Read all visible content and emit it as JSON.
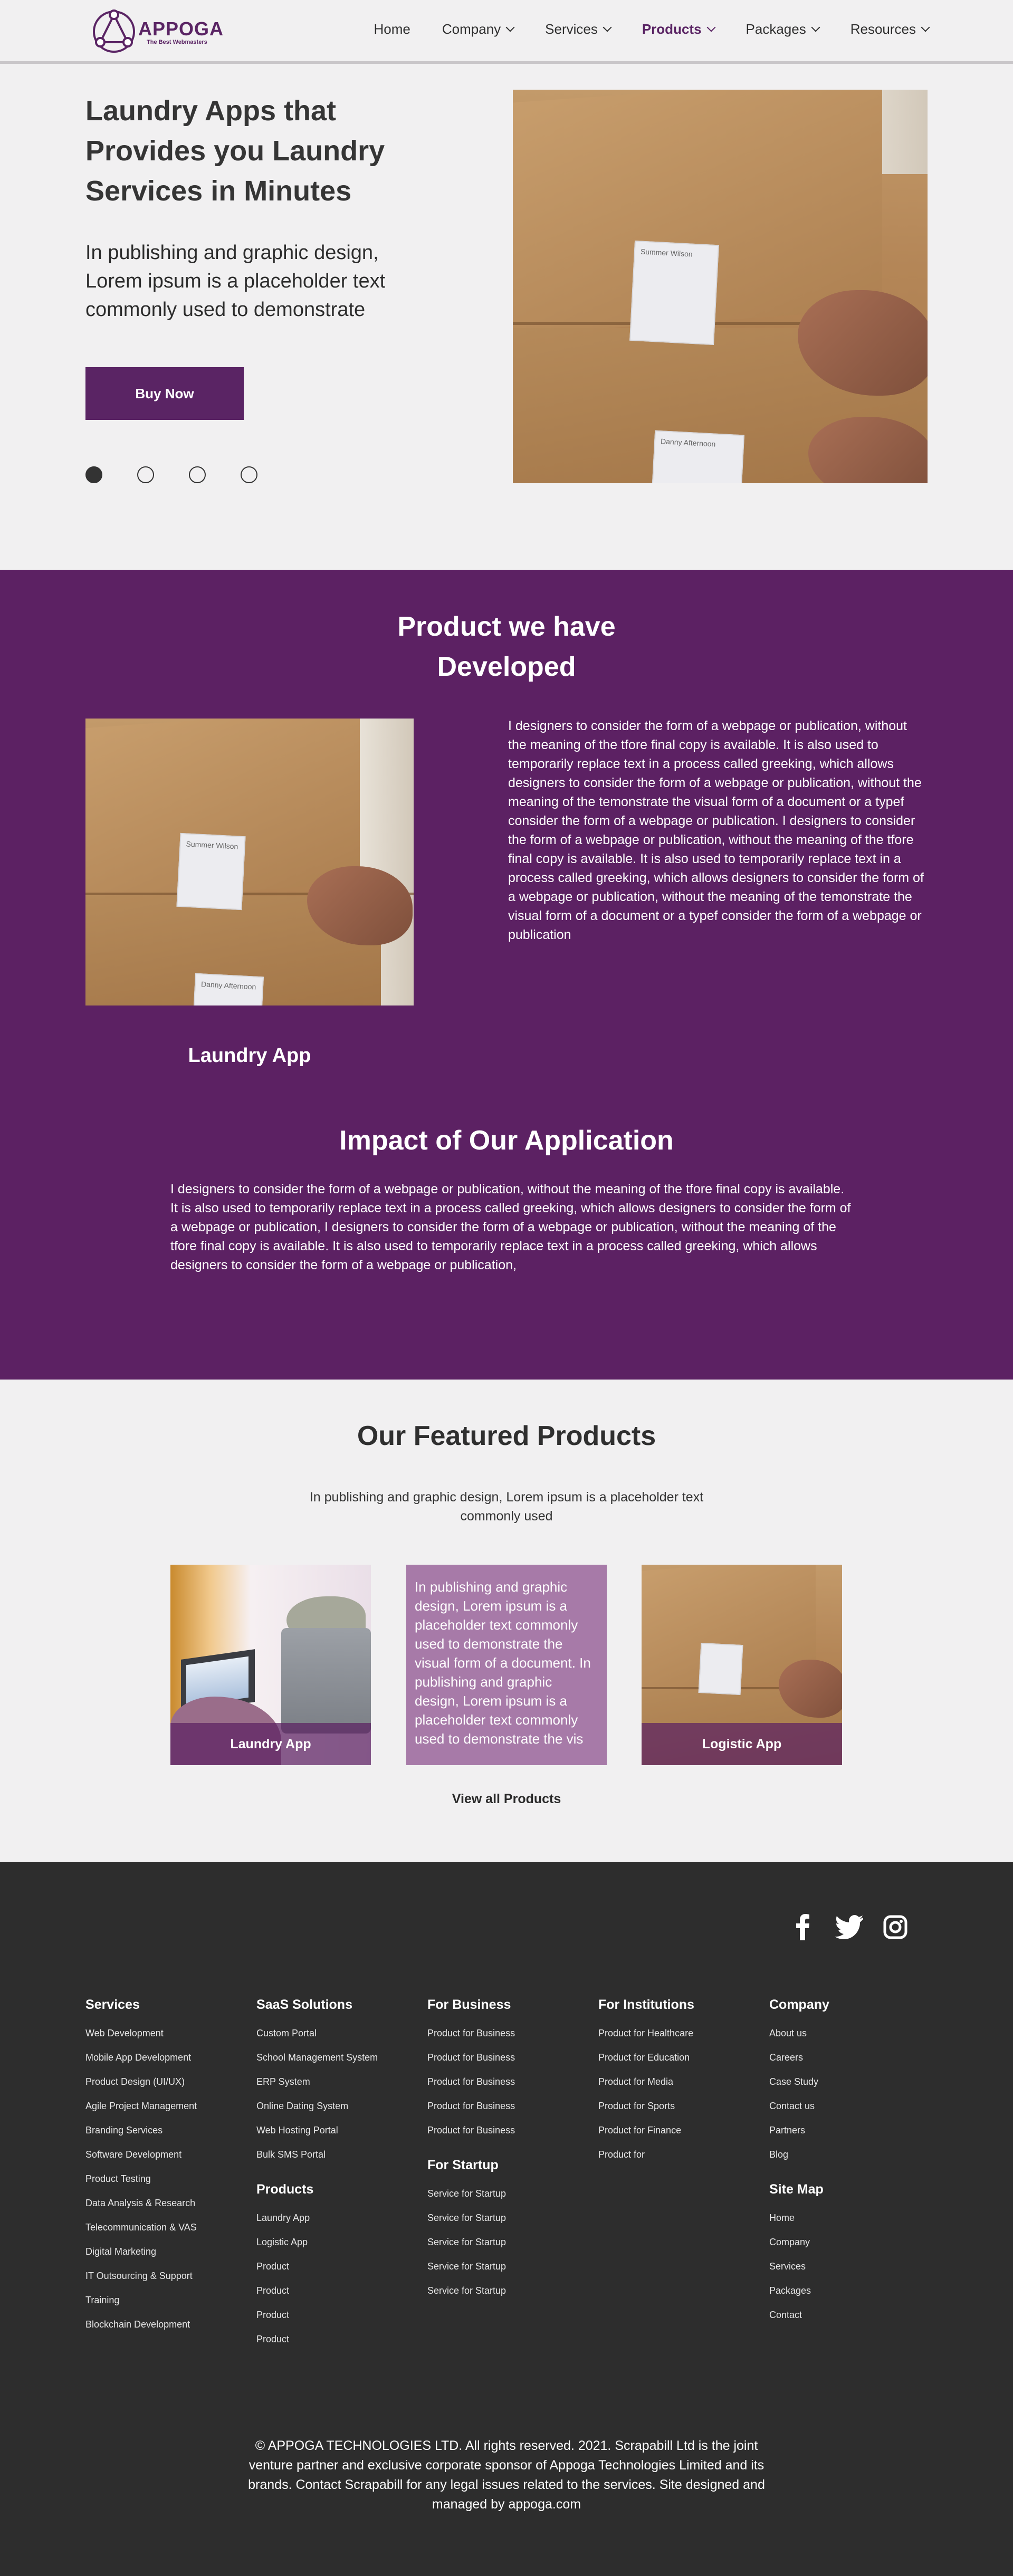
{
  "brand": {
    "name": "APPOGA",
    "tagline": "The Best Webmasters",
    "color_primary": "#5c2163",
    "color_dark": "#2d2d2d"
  },
  "nav": {
    "items": [
      {
        "label": "Home",
        "dropdown": false
      },
      {
        "label": "Company",
        "dropdown": true
      },
      {
        "label": "Services",
        "dropdown": true
      },
      {
        "label": "Products",
        "dropdown": true,
        "active": true
      },
      {
        "label": "Packages",
        "dropdown": true
      },
      {
        "label": "Resources",
        "dropdown": true
      }
    ]
  },
  "hero": {
    "title": "Laundry Apps that Provides you Laundry Services in Minutes",
    "subtitle": "In publishing and graphic design, Lorem ipsum is a placeholder text commonly used to demonstrate",
    "button": "Buy Now",
    "slides": 4,
    "active_slide": 1,
    "box_labels": [
      "Summer Wilson",
      "Danny Afternoon"
    ]
  },
  "products_section": {
    "title": "Product we have Developed",
    "description": "I designers to consider the form of a webpage or publication, without the meaning of the tfore final copy is available. It is also used to temporarily replace text in a process called greeking, which allows designers to consider the form of a webpage or publication, without the meaning of the temonstrate the visual form of a document or a typef consider the form of a webpage or publication. I designers to consider the form of a webpage or publication, without the meaning of the tfore final copy is available. It is also used to temporarily replace text in a process called greeking, which allows designers to consider the form of a webpage or publication, without the meaning of the temonstrate the visual form of a document or a typef consider the form of a webpage or publication",
    "product_name": "Laundry App"
  },
  "impact": {
    "title": "Impact of Our Application",
    "text": "I designers to consider the form of a webpage or publication, without the meaning of the tfore final copy is available. It is also used to temporarily replace text in a process called greeking, which allows designers to consider the form of a webpage or publication,  I designers to consider the form of a webpage or publication, without the meaning of the tfore final copy is available. It is also used to temporarily replace text in a process called greeking, which allows designers to consider the form of a webpage or publication,"
  },
  "featured": {
    "title": "Our Featured Products",
    "subtitle": "In publishing and graphic design, Lorem ipsum is a placeholder text commonly used",
    "cards": [
      {
        "caption": "Laundry App"
      },
      {
        "text": "In publishing and graphic design, Lorem ipsum is a placeholder text commonly used to demonstrate the visual form of a document. In publishing and graphic design, Lorem ipsum is a placeholder text commonly used to demonstrate the vis"
      },
      {
        "caption": "Logistic App"
      }
    ],
    "view_all": "View all Products"
  },
  "footer": {
    "social_icons": [
      "facebook-icon",
      "twitter-icon",
      "instagram-icon"
    ],
    "columns": [
      {
        "title": "Services",
        "links": [
          "Web Development",
          "Mobile App Development",
          "Product Design (UI/UX)",
          "Agile Project Management",
          "Branding Services",
          "Software Development",
          "Product Testing",
          "Data Analysis & Research",
          "Telecommunication & VAS",
          "Digital Marketing",
          "IT Outsourcing & Support",
          "Training",
          "Blockchain Development"
        ]
      },
      {
        "title": "SaaS Solutions",
        "links": [
          "Custom Portal",
          "School Management System",
          "ERP System",
          "Online Dating System",
          "Web Hosting Portal",
          "Bulk SMS Portal"
        ]
      },
      {
        "title": "Products",
        "links": [
          "Laundry App",
          "Logistic App",
          "Product",
          "Product",
          "Product",
          "Product"
        ]
      },
      {
        "title": "For Business",
        "links": [
          "Product for Business",
          "Product for Business",
          "Product for Business",
          "Product for Business",
          "Product for Business"
        ]
      },
      {
        "title": "For Startup",
        "links": [
          "Service for Startup",
          "Service for Startup",
          "Service for Startup",
          "Service for Startup",
          "Service for Startup"
        ]
      },
      {
        "title": "For Institutions",
        "links": [
          "Product for Healthcare",
          "Product for Education",
          "Product for Media",
          "Product for Sports",
          "Product for Finance",
          "Product for"
        ]
      },
      {
        "title": "Company",
        "links": [
          "About us",
          "Careers",
          "Case Study",
          "Contact us",
          "Partners",
          "Blog"
        ]
      },
      {
        "title": "Site Map",
        "links": [
          "Home",
          "Company",
          "Services",
          "Packages",
          "Contact"
        ]
      }
    ],
    "copyright": "© APPOGA TECHNOLOGIES LTD. All rights reserved. 2021. Scrapabill Ltd is the joint venture partner and exclusive corporate sponsor of Appoga Technologies Limited and its brands. Contact Scrapabill for any legal issues related to the services. Site designed and managed by appoga.com"
  }
}
